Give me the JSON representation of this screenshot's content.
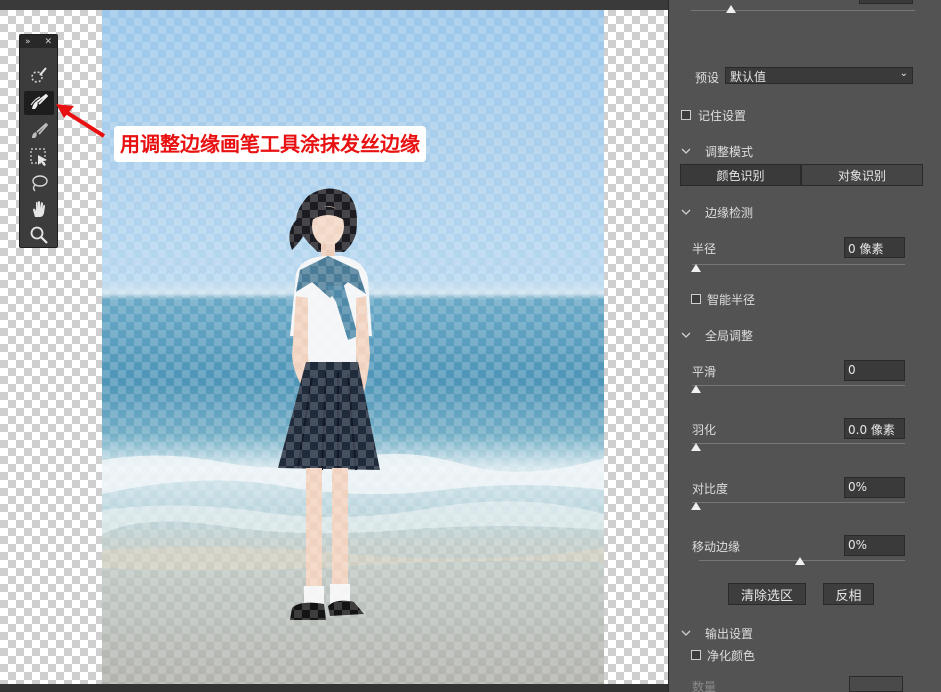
{
  "annotation": {
    "text": "用调整边缘画笔工具涂抹发丝边缘",
    "color": "#e81010"
  },
  "tools": [
    {
      "icon": "quick-selection-brush-icon"
    },
    {
      "icon": "refine-edge-brush-icon",
      "active": true
    },
    {
      "icon": "brush-icon"
    },
    {
      "icon": "object-selection-icon"
    },
    {
      "icon": "lasso-icon"
    },
    {
      "icon": "hand-icon"
    },
    {
      "icon": "zoom-icon"
    }
  ],
  "panel": {
    "preset_label": "预设",
    "preset_value": "默认值",
    "remember_settings": "记住设置",
    "refine_mode": {
      "title": "调整模式",
      "options": [
        "颜色识别",
        "对象识别"
      ],
      "selected": "颜色识别"
    },
    "edge_detection": {
      "title": "边缘检测",
      "radius_label": "半径",
      "radius_value": "0 像素",
      "smart_radius": "智能半径"
    },
    "global_refinements": {
      "title": "全局调整",
      "smooth_label": "平滑",
      "smooth_value": "0",
      "feather_label": "羽化",
      "feather_value": "0.0 像素",
      "contrast_label": "对比度",
      "contrast_value": "0%",
      "shift_edge_label": "移动边缘",
      "shift_edge_value": "0%",
      "clear_selection": "清除选区",
      "invert": "反相"
    },
    "output": {
      "title": "输出设置",
      "decontaminate": "净化颜色",
      "amount_label": "数量"
    }
  }
}
